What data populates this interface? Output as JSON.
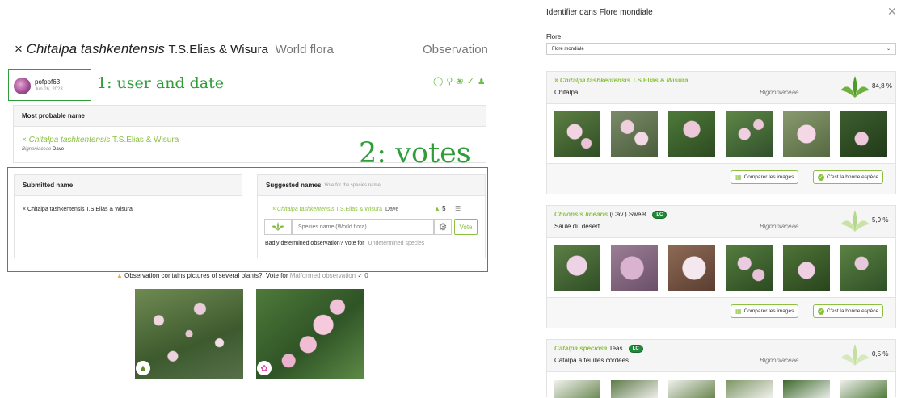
{
  "left": {
    "title_prefix": "×",
    "title_species": "Chitalpa tashkentensis",
    "title_author": "T.S.Elias & Wisura",
    "flora": "World flora",
    "observation_label": "Observation",
    "user": {
      "name": "pofpof63",
      "date": "Jun 26, 2023"
    },
    "annotation_1": "1: user and date",
    "annotation_2": "2: votes",
    "most_probable": {
      "header": "Most probable name",
      "species": "× Chitalpa tashkentensis",
      "author": "T.S.Elias & Wisura",
      "family": "Bignoniaceae",
      "voter": "Dave"
    },
    "submitted": {
      "header": "Submitted name",
      "name": "× Chitalpa tashkentensis T.S.Elias & Wisura"
    },
    "suggested": {
      "header": "Suggested names",
      "hint": "Vote for the species name",
      "species": "× Chitalpa tashkentensis",
      "author": "T.S.Elias & Wisura",
      "voter": "Dave",
      "vote_count": "5",
      "input_placeholder": "Species name (World flora)",
      "vote_button": "Vote",
      "bad_text": "Badly determined observation? Vote for",
      "undetermined_link": "Undetermined species"
    },
    "malformed": {
      "text": "Observation contains pictures of several plants?: Vote for",
      "link": "Malformed observation",
      "count": "0"
    }
  },
  "right": {
    "title": "Identifier dans Flore mondiale",
    "flore_label": "Flore",
    "flore_value": "Flore mondiale",
    "compare_label": "Comparer les images",
    "correct_label": "C'est la bonne espèce",
    "lc_badge": "LC",
    "results": [
      {
        "species": "× Chitalpa tashkentensis",
        "author": "T.S.Elias & Wisura",
        "common": "Chitalpa",
        "family": "Bignoniaceae",
        "score": "84,8 %",
        "lc": false
      },
      {
        "species": "Chilopsis linearis",
        "author": "(Cav.) Sweet",
        "common": "Saule du désert",
        "family": "Bignoniaceae",
        "score": "5,9 %",
        "lc": true
      },
      {
        "species": "Catalpa speciosa",
        "author": "Teas",
        "common": "Catalpa à feuilles cordées",
        "family": "Bignoniaceae",
        "score": "0,5 %",
        "lc": true
      }
    ]
  },
  "colors": {
    "accent": "#8cc03f",
    "annotation": "#2e9d3a",
    "warning": "#f5a623"
  }
}
